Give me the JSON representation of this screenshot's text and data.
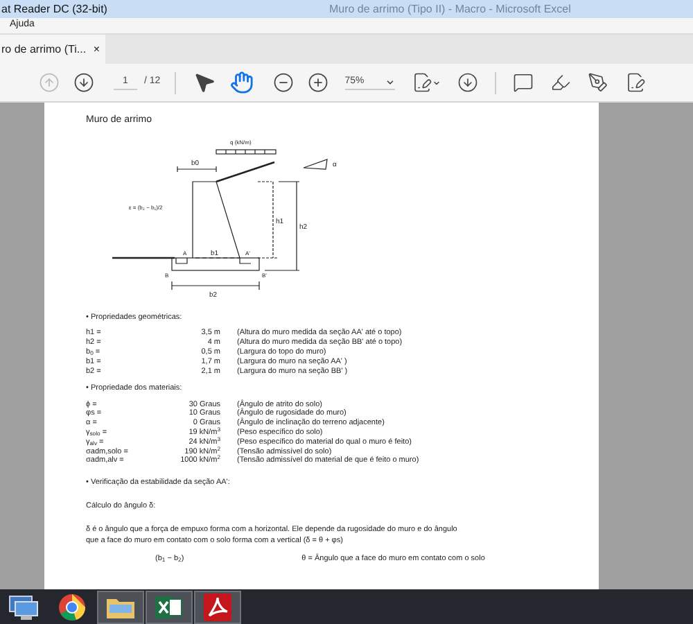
{
  "title_bar": {
    "title": "at Reader DC (32-bit)",
    "background_title": "Muro de arrimo (Tipo II) - Macro - Microsoft Excel"
  },
  "menu": [
    "Ajuda"
  ],
  "tabs": [
    {
      "label": "ro de arrimo (Ti...",
      "selected": true,
      "close": "×"
    }
  ],
  "toolbar": {
    "prev_disabled": true,
    "page": "1",
    "total": "/ 12",
    "zoom": "75%",
    "tools": [
      {
        "kind": "select",
        "selected": false
      },
      {
        "kind": "hand",
        "selected": true
      }
    ]
  },
  "document": {
    "heading": "Muro de arrimo",
    "diagram": {
      "load": "q (kN/m)",
      "b0": "b0",
      "alpha": "α",
      "epsilon": "ε = (b₂ − b₁)/2",
      "h1": "h1",
      "h2": "h2",
      "a": "A",
      "a_prime": "A'",
      "b1": "b1",
      "b": "B",
      "b_prime": "B'",
      "b2": "b2"
    },
    "sections": [
      {
        "title": "• Propriedades geométricas:",
        "rows": [
          {
            "symbol": "h1 =",
            "value": "3,5 m",
            "description": "(Altura do muro medida da seção AA' até o topo)"
          },
          {
            "symbol": "h2 =",
            "value": "4 m",
            "description": "(Altura do muro medida da seção BB' até o topo)"
          },
          {
            "symbol": "b$_{0}$ =",
            "value": "0,5 m",
            "description": "(Largura do topo do muro)"
          },
          {
            "symbol": "b1 =",
            "value": "1,7 m",
            "description": "(Largura do muro na seção AA' )"
          },
          {
            "symbol": "b2 =",
            "value": "2,1 m",
            "description": "(Largura do muro na seção BB' )"
          }
        ]
      },
      {
        "title": "• Propriedade dos materiais:",
        "rows": [
          {
            "symbol": "ϕ =",
            "value": "30 Graus",
            "description": "(Ângulo de atrito do solo)"
          },
          {
            "symbol": "φs =",
            "value": "10 Graus",
            "description": "(Ângulo de rugosidade do muro)"
          },
          {
            "symbol": "α =",
            "value": "0 Graus",
            "description": "(Ângulo de inclinação do terreno adjacente)"
          },
          {
            "symbol": "γ$_{solo}$ =",
            "value": "19 kN/m$^{3}$",
            "description": "(Peso específico do solo)"
          },
          {
            "symbol": "γ$_{alv}$ =",
            "value": "24 kN/m$^{3}$",
            "description": "(Peso específico do material do qual o muro é feito)"
          },
          {
            "symbol": "σadm,solo =",
            "value": "190 kN/m$^{2}$",
            "description": "(Tensão admissível do solo)"
          },
          {
            "symbol": "σadm,alv =",
            "value": "1000 kN/m$^{2}$",
            "description": "(Tensão admissível do material de que é feito o muro)"
          }
        ]
      }
    ],
    "verification": "• Verificação da estabilidade da seção AA':",
    "subheading": "Cálculo do ângulo δ:",
    "paragraph": "δ é o ângulo que a força de empuxo forma com a horizontal. Ele depende da rugosidade do muro e do ângulo que a face do muro em contato com o solo forma com a vertical (δ = θ + φs)",
    "formula": "(b$_{1}$ − b$_{2}$)",
    "theta_note": "θ = Ângulo que a face do muro em contato com o solo"
  },
  "taskbar": [
    {
      "kind": "network",
      "active": false
    },
    {
      "kind": "chrome",
      "active": false
    },
    {
      "kind": "folder",
      "active": true
    },
    {
      "kind": "excel",
      "active": true
    },
    {
      "kind": "pdf",
      "active": true
    }
  ]
}
